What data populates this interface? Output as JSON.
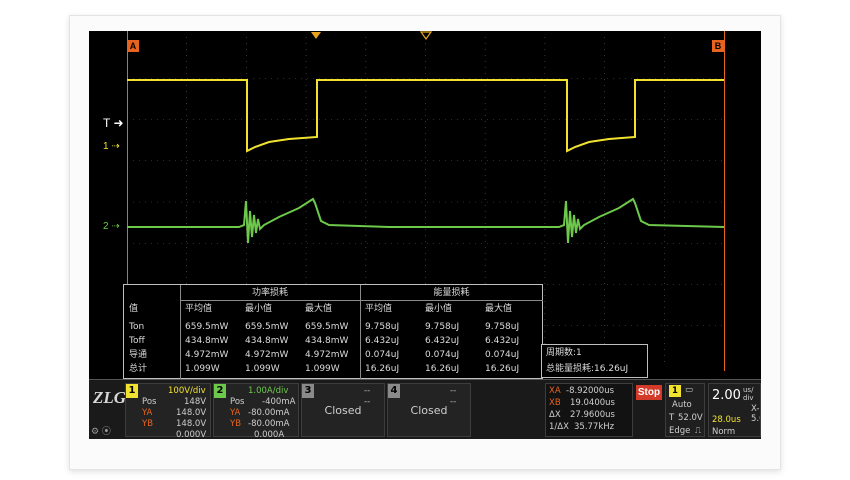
{
  "markers": {
    "a": "A",
    "b": "B"
  },
  "channel_labels": {
    "trigger": "T",
    "ch1": "1",
    "ch2": "2"
  },
  "colors": {
    "ch1": "#f2e230",
    "ch2": "#6dc94a",
    "grid": "#5a5a5a",
    "cursor": "#e8641e",
    "stop": "#d43a2a"
  },
  "measure_table": {
    "group_headers": [
      "功率损耗",
      "能量损耗"
    ],
    "columns": [
      "值",
      "平均值",
      "最小值",
      "最大值",
      "平均值",
      "最小值",
      "最大值"
    ],
    "rows": [
      [
        "Ton",
        "659.5mW",
        "659.5mW",
        "659.5mW",
        "9.758uJ",
        "9.758uJ",
        "9.758uJ"
      ],
      [
        "Toff",
        "434.8mW",
        "434.8mW",
        "434.8mW",
        "6.432uJ",
        "6.432uJ",
        "6.432uJ"
      ],
      [
        "导通",
        "4.972mW",
        "4.972mW",
        "4.972mW",
        "0.074uJ",
        "0.074uJ",
        "0.074uJ"
      ],
      [
        "总计",
        "1.099W",
        "1.099W",
        "1.099W",
        "16.26uJ",
        "16.26uJ",
        "16.26uJ"
      ]
    ]
  },
  "summary": {
    "cycles": "周期数:1",
    "total_energy": "总能量损耗:16.26uJ"
  },
  "status_bar": {
    "logo": "ZLG",
    "ch1": {
      "num": "1",
      "scale": "100V/div",
      "pos_label": "Pos",
      "pos": "148V",
      "ya_label": "YA",
      "ya": "148.0V",
      "yb_label": "YB",
      "yb": "148.0V",
      "dy": "0.000V"
    },
    "ch2": {
      "num": "2",
      "scale": "1.00A/div",
      "pos_label": "Pos",
      "pos": "-400mA",
      "ya_label": "YA",
      "ya": "-80.00mA",
      "yb_label": "YB",
      "yb": "-80.00mA",
      "dy": "0.000A"
    },
    "ch3": {
      "num": "3",
      "dash1": "--",
      "dash2": "--",
      "state": "Closed"
    },
    "ch4": {
      "num": "4",
      "dash1": "--",
      "dash2": "--",
      "state": "Closed"
    },
    "cursors": {
      "xa_label": "XA",
      "xa": "-8.92000us",
      "xb_label": "XB",
      "xb": "19.0400us",
      "dx_label": "ΔX",
      "dx": "27.9600us",
      "inv_label": "1/ΔX",
      "inv": "35.77kHz"
    },
    "run_state": "Stop",
    "trigger": {
      "source": "1",
      "mode": "Auto",
      "type": "T",
      "level": "52.0V",
      "edge_label": "Edge"
    },
    "timebase": {
      "value": "2.00",
      "unit_top": "us/",
      "unit_bottom": "div",
      "xpos_label": "X-Po",
      "xpos": "5.08",
      "delay": "28.0us",
      "rate_top": "56.0Kp",
      "mode": "Norm",
      "rate": "2.00GSa"
    }
  }
}
